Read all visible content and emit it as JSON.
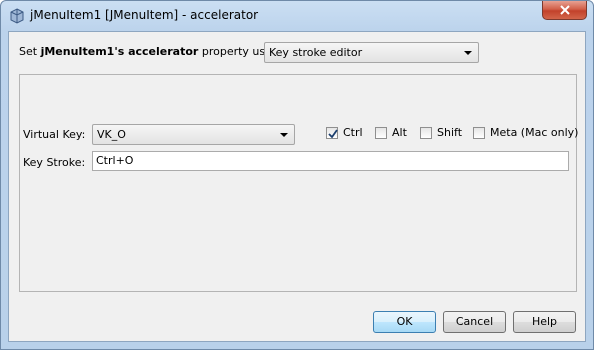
{
  "window": {
    "title": "jMenuItem1 [JMenuItem] - accelerator",
    "icon": "bean-property-icon"
  },
  "mode_row": {
    "prefix": "Set ",
    "component": "jMenuItem1",
    "possessive": "'s ",
    "property": "accelerator",
    "suffix": " property using:",
    "selected_editor": "Key stroke editor"
  },
  "editor": {
    "virtual_key_label": "Virtual Key:",
    "virtual_key_value": "VK_O",
    "modifiers": [
      {
        "label": "Ctrl",
        "checked": true
      },
      {
        "label": "Alt",
        "checked": false
      },
      {
        "label": "Shift",
        "checked": false
      },
      {
        "label": "Meta (Mac only)",
        "checked": false
      }
    ],
    "key_stroke_label": "Key Stroke:",
    "key_stroke_value": "Ctrl+O"
  },
  "buttons": {
    "ok": "OK",
    "cancel": "Cancel",
    "help": "Help"
  },
  "colors": {
    "titlebar": "#bcd3ec",
    "close_button": "#c2422b",
    "dialog_background": "#f0f0f0",
    "default_button": "#bee6fd"
  }
}
